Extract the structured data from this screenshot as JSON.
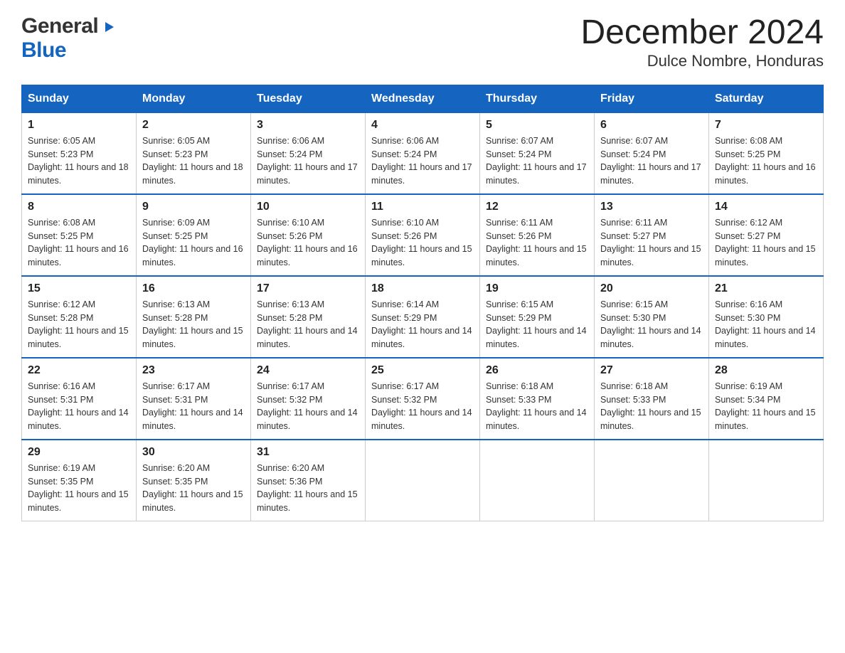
{
  "header": {
    "logo_general": "General",
    "logo_blue": "Blue",
    "month_title": "December 2024",
    "location": "Dulce Nombre, Honduras"
  },
  "weekdays": [
    "Sunday",
    "Monday",
    "Tuesday",
    "Wednesday",
    "Thursday",
    "Friday",
    "Saturday"
  ],
  "weeks": [
    [
      {
        "day": "1",
        "sunrise": "6:05 AM",
        "sunset": "5:23 PM",
        "daylight": "11 hours and 18 minutes."
      },
      {
        "day": "2",
        "sunrise": "6:05 AM",
        "sunset": "5:23 PM",
        "daylight": "11 hours and 18 minutes."
      },
      {
        "day": "3",
        "sunrise": "6:06 AM",
        "sunset": "5:24 PM",
        "daylight": "11 hours and 17 minutes."
      },
      {
        "day": "4",
        "sunrise": "6:06 AM",
        "sunset": "5:24 PM",
        "daylight": "11 hours and 17 minutes."
      },
      {
        "day": "5",
        "sunrise": "6:07 AM",
        "sunset": "5:24 PM",
        "daylight": "11 hours and 17 minutes."
      },
      {
        "day": "6",
        "sunrise": "6:07 AM",
        "sunset": "5:24 PM",
        "daylight": "11 hours and 17 minutes."
      },
      {
        "day": "7",
        "sunrise": "6:08 AM",
        "sunset": "5:25 PM",
        "daylight": "11 hours and 16 minutes."
      }
    ],
    [
      {
        "day": "8",
        "sunrise": "6:08 AM",
        "sunset": "5:25 PM",
        "daylight": "11 hours and 16 minutes."
      },
      {
        "day": "9",
        "sunrise": "6:09 AM",
        "sunset": "5:25 PM",
        "daylight": "11 hours and 16 minutes."
      },
      {
        "day": "10",
        "sunrise": "6:10 AM",
        "sunset": "5:26 PM",
        "daylight": "11 hours and 16 minutes."
      },
      {
        "day": "11",
        "sunrise": "6:10 AM",
        "sunset": "5:26 PM",
        "daylight": "11 hours and 15 minutes."
      },
      {
        "day": "12",
        "sunrise": "6:11 AM",
        "sunset": "5:26 PM",
        "daylight": "11 hours and 15 minutes."
      },
      {
        "day": "13",
        "sunrise": "6:11 AM",
        "sunset": "5:27 PM",
        "daylight": "11 hours and 15 minutes."
      },
      {
        "day": "14",
        "sunrise": "6:12 AM",
        "sunset": "5:27 PM",
        "daylight": "11 hours and 15 minutes."
      }
    ],
    [
      {
        "day": "15",
        "sunrise": "6:12 AM",
        "sunset": "5:28 PM",
        "daylight": "11 hours and 15 minutes."
      },
      {
        "day": "16",
        "sunrise": "6:13 AM",
        "sunset": "5:28 PM",
        "daylight": "11 hours and 15 minutes."
      },
      {
        "day": "17",
        "sunrise": "6:13 AM",
        "sunset": "5:28 PM",
        "daylight": "11 hours and 14 minutes."
      },
      {
        "day": "18",
        "sunrise": "6:14 AM",
        "sunset": "5:29 PM",
        "daylight": "11 hours and 14 minutes."
      },
      {
        "day": "19",
        "sunrise": "6:15 AM",
        "sunset": "5:29 PM",
        "daylight": "11 hours and 14 minutes."
      },
      {
        "day": "20",
        "sunrise": "6:15 AM",
        "sunset": "5:30 PM",
        "daylight": "11 hours and 14 minutes."
      },
      {
        "day": "21",
        "sunrise": "6:16 AM",
        "sunset": "5:30 PM",
        "daylight": "11 hours and 14 minutes."
      }
    ],
    [
      {
        "day": "22",
        "sunrise": "6:16 AM",
        "sunset": "5:31 PM",
        "daylight": "11 hours and 14 minutes."
      },
      {
        "day": "23",
        "sunrise": "6:17 AM",
        "sunset": "5:31 PM",
        "daylight": "11 hours and 14 minutes."
      },
      {
        "day": "24",
        "sunrise": "6:17 AM",
        "sunset": "5:32 PM",
        "daylight": "11 hours and 14 minutes."
      },
      {
        "day": "25",
        "sunrise": "6:17 AM",
        "sunset": "5:32 PM",
        "daylight": "11 hours and 14 minutes."
      },
      {
        "day": "26",
        "sunrise": "6:18 AM",
        "sunset": "5:33 PM",
        "daylight": "11 hours and 14 minutes."
      },
      {
        "day": "27",
        "sunrise": "6:18 AM",
        "sunset": "5:33 PM",
        "daylight": "11 hours and 15 minutes."
      },
      {
        "day": "28",
        "sunrise": "6:19 AM",
        "sunset": "5:34 PM",
        "daylight": "11 hours and 15 minutes."
      }
    ],
    [
      {
        "day": "29",
        "sunrise": "6:19 AM",
        "sunset": "5:35 PM",
        "daylight": "11 hours and 15 minutes."
      },
      {
        "day": "30",
        "sunrise": "6:20 AM",
        "sunset": "5:35 PM",
        "daylight": "11 hours and 15 minutes."
      },
      {
        "day": "31",
        "sunrise": "6:20 AM",
        "sunset": "5:36 PM",
        "daylight": "11 hours and 15 minutes."
      },
      {
        "day": "",
        "sunrise": "",
        "sunset": "",
        "daylight": ""
      },
      {
        "day": "",
        "sunrise": "",
        "sunset": "",
        "daylight": ""
      },
      {
        "day": "",
        "sunrise": "",
        "sunset": "",
        "daylight": ""
      },
      {
        "day": "",
        "sunrise": "",
        "sunset": "",
        "daylight": ""
      }
    ]
  ],
  "labels": {
    "sunrise_prefix": "Sunrise: ",
    "sunset_prefix": "Sunset: ",
    "daylight_prefix": "Daylight: "
  }
}
